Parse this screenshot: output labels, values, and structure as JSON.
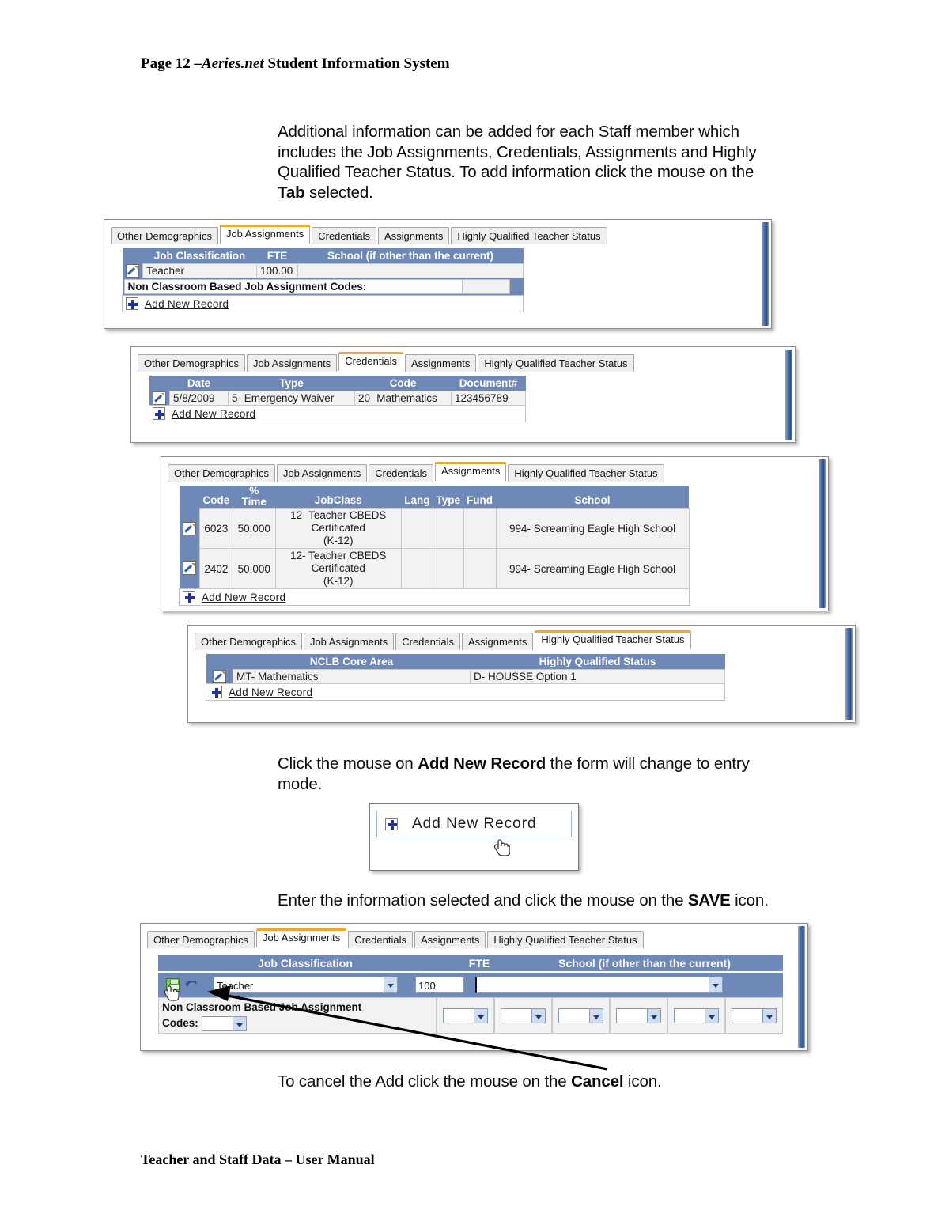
{
  "document": {
    "header": {
      "prefix": "Page 12 –",
      "italic": "Aeries.net",
      "suffix": " Student Information System"
    },
    "footer": "Teacher and Staff Data – User Manual"
  },
  "paragraphs": {
    "intro_l1": "Additional information can be added for each Staff member which",
    "intro_l2": "includes the Job Assignments, Credentials, Assignments and Highly",
    "intro_l3": "Qualified Teacher Status.  To add information click the mouse on the",
    "intro_l4_bold": "Tab",
    "intro_l4_rest": " selected.",
    "addrec_pre": "Click the mouse on ",
    "addrec_bold": "Add New Record",
    "addrec_post": " the form will change to entry",
    "addrec_l2": "mode.",
    "save_pre": "Enter the information selected and click the mouse on the ",
    "save_bold": "SAVE",
    "save_post": " icon.",
    "cancel_pre": "To cancel the Add click the mouse on the ",
    "cancel_bold": "Cancel",
    "cancel_post": " icon."
  },
  "tabs": {
    "other_demographics": "Other Demographics",
    "job_assignments": "Job Assignments",
    "credentials": "Credentials",
    "assignments": "Assignments",
    "hqts": "Highly Qualified Teacher Status"
  },
  "common": {
    "add_new_record": "Add New Record",
    "edit_icon": "edit-pencil-icon",
    "plus_icon": "plus-add-icon",
    "save_icon": "save-floppy-icon",
    "cancel_icon": "undo-cancel-icon",
    "cursor_icon": "hand-cursor-icon",
    "header_blue": "#6e88b8",
    "active_tab_accent": "#f0a830",
    "row_background": "#f2f2f2"
  },
  "panel_job_assignments": {
    "active_tab": "Job Assignments",
    "columns": [
      "Job Classification",
      "FTE",
      "School (if other than the current)"
    ],
    "rows": [
      {
        "job_classification": "Teacher",
        "fte": "100.00",
        "school": ""
      }
    ],
    "non_classroom_label": "Non Classroom Based Job Assignment Codes:",
    "add_new_record": "Add New Record"
  },
  "panel_credentials": {
    "active_tab": "Credentials",
    "columns": [
      "Date",
      "Type",
      "Code",
      "Document#"
    ],
    "rows": [
      {
        "date": "5/8/2009",
        "type": "5- Emergency Waiver",
        "code": "20- Mathematics",
        "document": "123456789"
      }
    ],
    "add_new_record": "Add New Record"
  },
  "panel_assignments": {
    "active_tab": "Assignments",
    "columns": [
      "Code",
      "% Time",
      "JobClass",
      "Lang",
      "Type",
      "Fund",
      "School"
    ],
    "pct_symbol": "%",
    "time_label": "Time",
    "rows": [
      {
        "code": "6023",
        "pct_time": "50.000",
        "jobclass_l1": "12- Teacher CBEDS Certificated",
        "jobclass_l2": "(K-12)",
        "lang": "",
        "type": "",
        "fund": "",
        "school": "994- Screaming Eagle High School"
      },
      {
        "code": "2402",
        "pct_time": "50.000",
        "jobclass_l1": "12- Teacher CBEDS Certificated",
        "jobclass_l2": "(K-12)",
        "lang": "",
        "type": "",
        "fund": "",
        "school": "994- Screaming Eagle High School"
      }
    ],
    "add_new_record": "Add New Record"
  },
  "panel_hqts": {
    "active_tab": "Highly Qualified Teacher Status",
    "columns": [
      "NCLB Core Area",
      "Highly Qualified Status"
    ],
    "rows": [
      {
        "core_area": "MT- Mathematics",
        "status": "D- HOUSSE Option 1"
      }
    ],
    "add_new_record": "Add New Record"
  },
  "callout_add_new": {
    "label": "Add New Record"
  },
  "panel_entry_form": {
    "active_tab": "Job Assignments",
    "columns": [
      "Job Classification",
      "FTE",
      "School (if other than the current)"
    ],
    "job_classification_value": "Teacher",
    "fte_value": "100",
    "school_value": "",
    "non_classroom_label_l1": "Non Classroom Based Job Assignment",
    "non_classroom_label_l2": "Codes:",
    "code_value": "",
    "extra_code_values": [
      "",
      "",
      "",
      "",
      "",
      ""
    ]
  }
}
